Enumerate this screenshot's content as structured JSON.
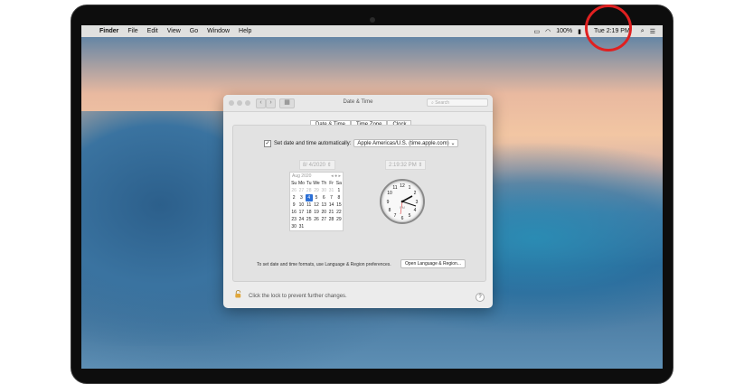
{
  "menubar": {
    "apple": "",
    "app": "Finder",
    "items": [
      "File",
      "Edit",
      "View",
      "Go",
      "Window",
      "Help"
    ],
    "battery": "100%",
    "clock": "Tue 2:19 PM"
  },
  "window": {
    "title": "Date & Time",
    "search_placeholder": "Search",
    "tabs": [
      "Date & Time",
      "Time Zone",
      "Clock"
    ],
    "auto_label": "Set date and time automatically:",
    "server": "Apple Americas/U.S. (time.apple.com)",
    "date_value": "8/ 4/2020",
    "time_value": "2:19:32 PM",
    "calendar": {
      "month": "Aug 2020",
      "weekdays": [
        "Su",
        "Mo",
        "Tu",
        "We",
        "Th",
        "Fr",
        "Sa"
      ],
      "days": [
        "26",
        "27",
        "28",
        "29",
        "30",
        "31",
        "1",
        "2",
        "3",
        "4",
        "5",
        "6",
        "7",
        "8",
        "9",
        "10",
        "11",
        "12",
        "13",
        "14",
        "15",
        "16",
        "17",
        "18",
        "19",
        "20",
        "21",
        "22",
        "23",
        "24",
        "25",
        "26",
        "27",
        "28",
        "29",
        "30",
        "31"
      ],
      "selected": "4"
    },
    "clock_ampm": "PM",
    "footnote": "To set date and time formats, use Language & Region preferences.",
    "region_button": "Open Language & Region...",
    "lock_text": "Click the lock to prevent further changes.",
    "help": "?"
  },
  "colors": {
    "highlight_circle": "#e02020",
    "selected_day": "#2b6fd6"
  }
}
